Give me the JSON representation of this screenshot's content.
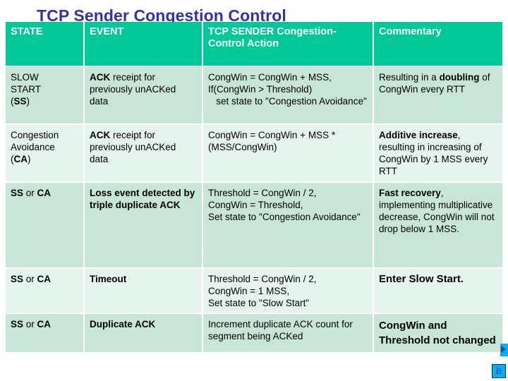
{
  "slide": {
    "title": "TCP Sender Congestion Control",
    "title_color": "#3333a6",
    "header_bg": "#00c896",
    "row_shade_dark": "#c7e6d7",
    "row_shade_light": "#e4f3ec",
    "accent_cyan": "#00b0f0"
  },
  "table": {
    "headers": [
      "STATE",
      "EVENT",
      "TCP SENDER Congestion-Control Action",
      "Commentary"
    ],
    "rows": [
      {
        "state_plain_1": "SLOW",
        "state_plain_2": "START",
        "state_paren_open": "(",
        "state_bold": "SS",
        "state_paren_close": ")",
        "event_bold": "ACK",
        "event_rest": " receipt for previously unACKed data",
        "action": "CongWin = CongWin + MSS,\nIf(CongWin > Threshold)\n   set state to \"Congestion Avoidance\"",
        "commentary_pre": "Resulting in a ",
        "commentary_bold": "doubling",
        "commentary_post": " of CongWin every RTT"
      },
      {
        "state_plain_1": "Congestion",
        "state_plain_2": "Avoidance",
        "state_paren_open": "(",
        "state_bold": "CA",
        "state_paren_close": ")",
        "event_bold": "ACK",
        "event_rest": " receipt for previously unACKed data",
        "action": "CongWin = CongWin + MSS * (MSS/CongWin)",
        "commentary_pre": "",
        "commentary_bold": "Additive increase",
        "commentary_post": ", resulting in increasing of CongWin by 1 MSS every RTT"
      },
      {
        "state_bold_a": "SS",
        "state_mid": " or ",
        "state_bold_b": "CA",
        "event_bold": "Loss event detected by triple duplicate ACK",
        "event_rest": "",
        "action": "Threshold = CongWin / 2,\nCongWin = Threshold,\nSet state to \"Congestion Avoidance\"",
        "commentary_pre": "",
        "commentary_bold": "Fast recovery",
        "commentary_post": ", implementing multiplicative decrease, CongWin will not drop below 1 MSS."
      },
      {
        "state_bold_a": "SS",
        "state_mid": " or ",
        "state_bold_b": "CA",
        "event_bold": "Timeout",
        "event_rest": "",
        "action": "Threshold = CongWin / 2,\nCongWin = 1 MSS,\nSet state to \"Slow Start\"",
        "commentary_pre": "Enter ",
        "commentary_bold": "Slow Start.",
        "commentary_post": ""
      },
      {
        "state_bold_a": "SS",
        "state_mid": " or ",
        "state_bold_b": "CA",
        "event_bold": "Duplicate ACK",
        "event_rest": "",
        "action": "Increment duplicate ACK count for segment being ACKed",
        "commentary_pre": "",
        "commentary_bold": "CongWin and Threshold not changed",
        "commentary_post": ""
      }
    ]
  },
  "decorations": {
    "corner_badge_label": "B"
  }
}
